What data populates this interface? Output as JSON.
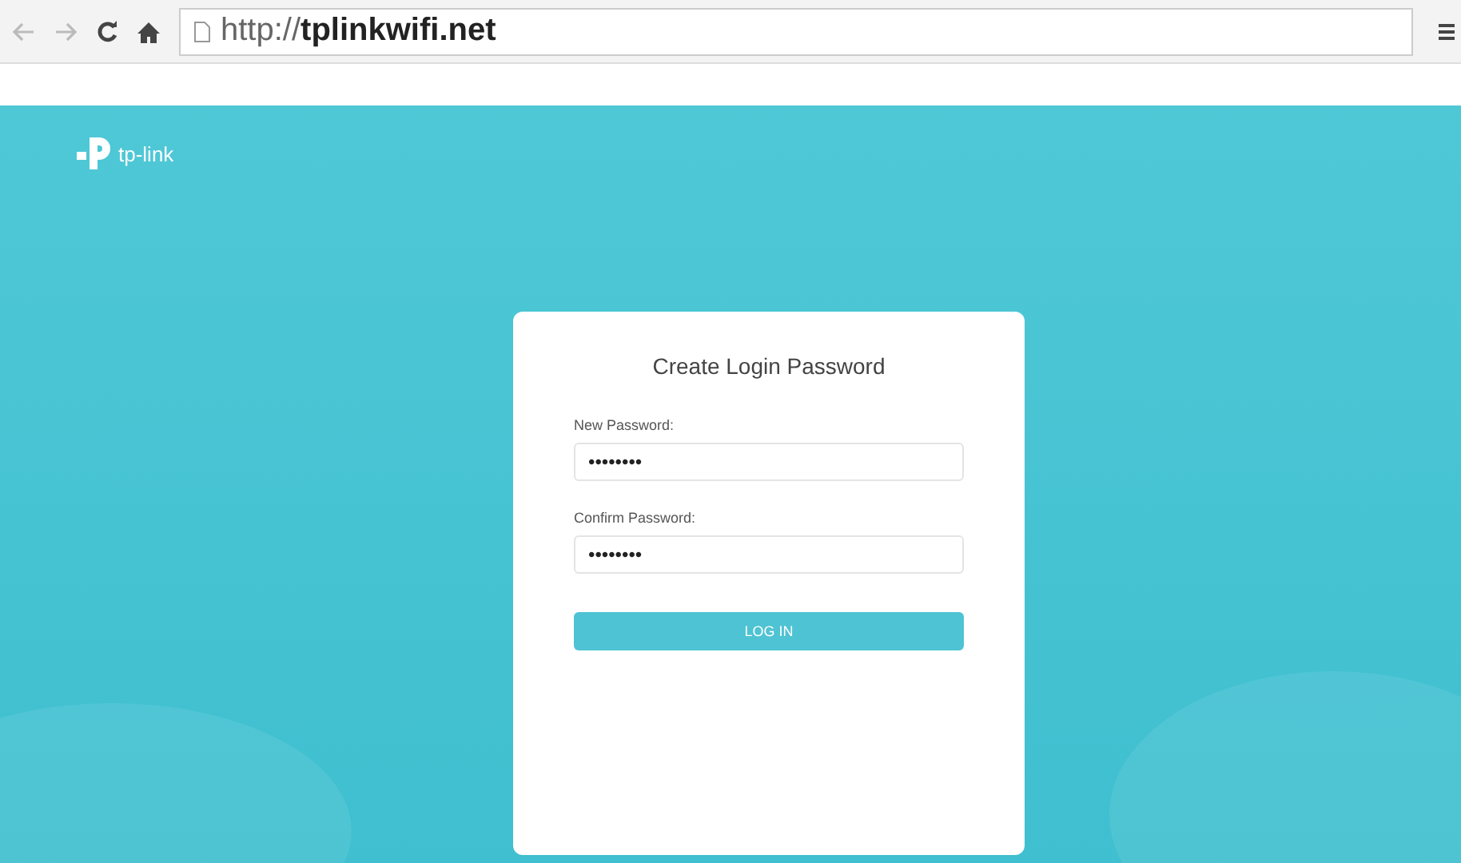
{
  "browser": {
    "url": "http://**tplinkwifi.net**"
  },
  "header": {
    "brand": "tp-link"
  },
  "card": {
    "title": "Create Login Password",
    "fields": [
      {
        "label": "New Password:",
        "value": "••••••••"
      },
      {
        "label": "Confirm Password:",
        "value": "••••••••"
      }
    ],
    "button": "LOG IN"
  }
}
